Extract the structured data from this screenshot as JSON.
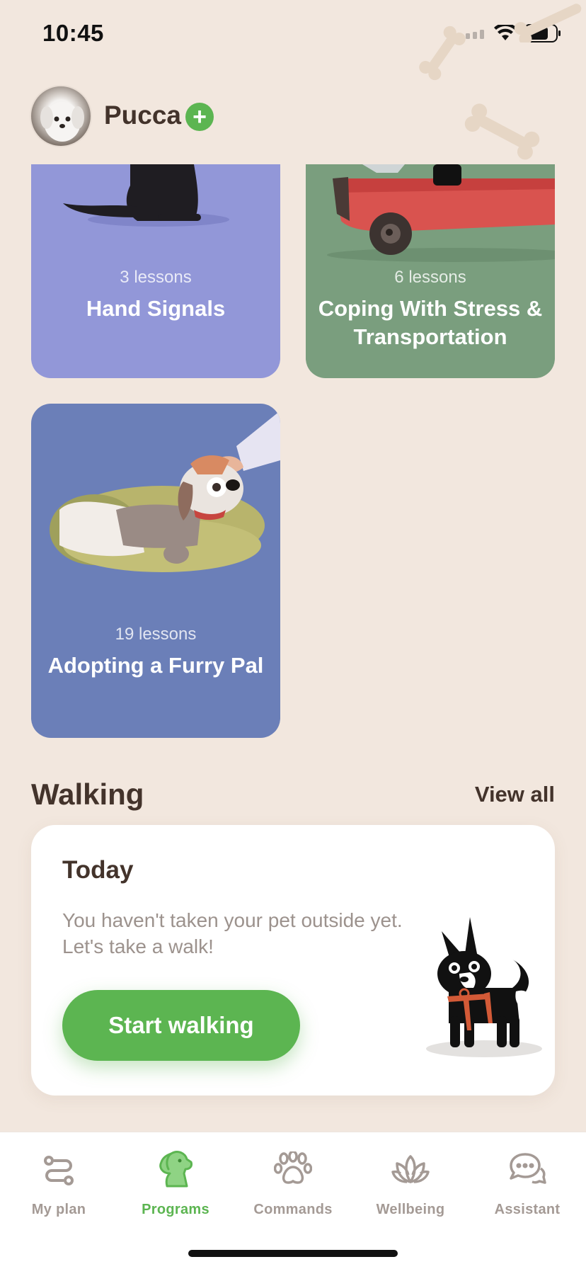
{
  "status_bar": {
    "time": "10:45"
  },
  "header": {
    "pet_name": "Pucca",
    "add_label": "+"
  },
  "programs": [
    {
      "lessons": "3 lessons",
      "title": "Hand Signals",
      "color": "#9297d8"
    },
    {
      "lessons": "6 lessons",
      "title": "Coping With Stress & Transportation",
      "color": "#7a9e7e"
    },
    {
      "lessons": "19 lessons",
      "title": "Adopting a Furry Pal",
      "color": "#6b7fb8"
    }
  ],
  "walking": {
    "section_title": "Walking",
    "view_all": "View all",
    "card_title": "Today",
    "message": "You haven't taken your pet outside yet. Let's take a walk!",
    "button": "Start walking"
  },
  "tabs": [
    {
      "label": "My plan",
      "icon": "route-icon",
      "active": false
    },
    {
      "label": "Programs",
      "icon": "dog-head-icon",
      "active": true
    },
    {
      "label": "Commands",
      "icon": "paw-icon",
      "active": false
    },
    {
      "label": "Wellbeing",
      "icon": "lotus-icon",
      "active": false
    },
    {
      "label": "Assistant",
      "icon": "chat-bubbles-icon",
      "active": false
    }
  ],
  "colors": {
    "accent": "#5cb551",
    "background": "#f2e7de",
    "text": "#43332b",
    "muted": "#a49a95"
  }
}
